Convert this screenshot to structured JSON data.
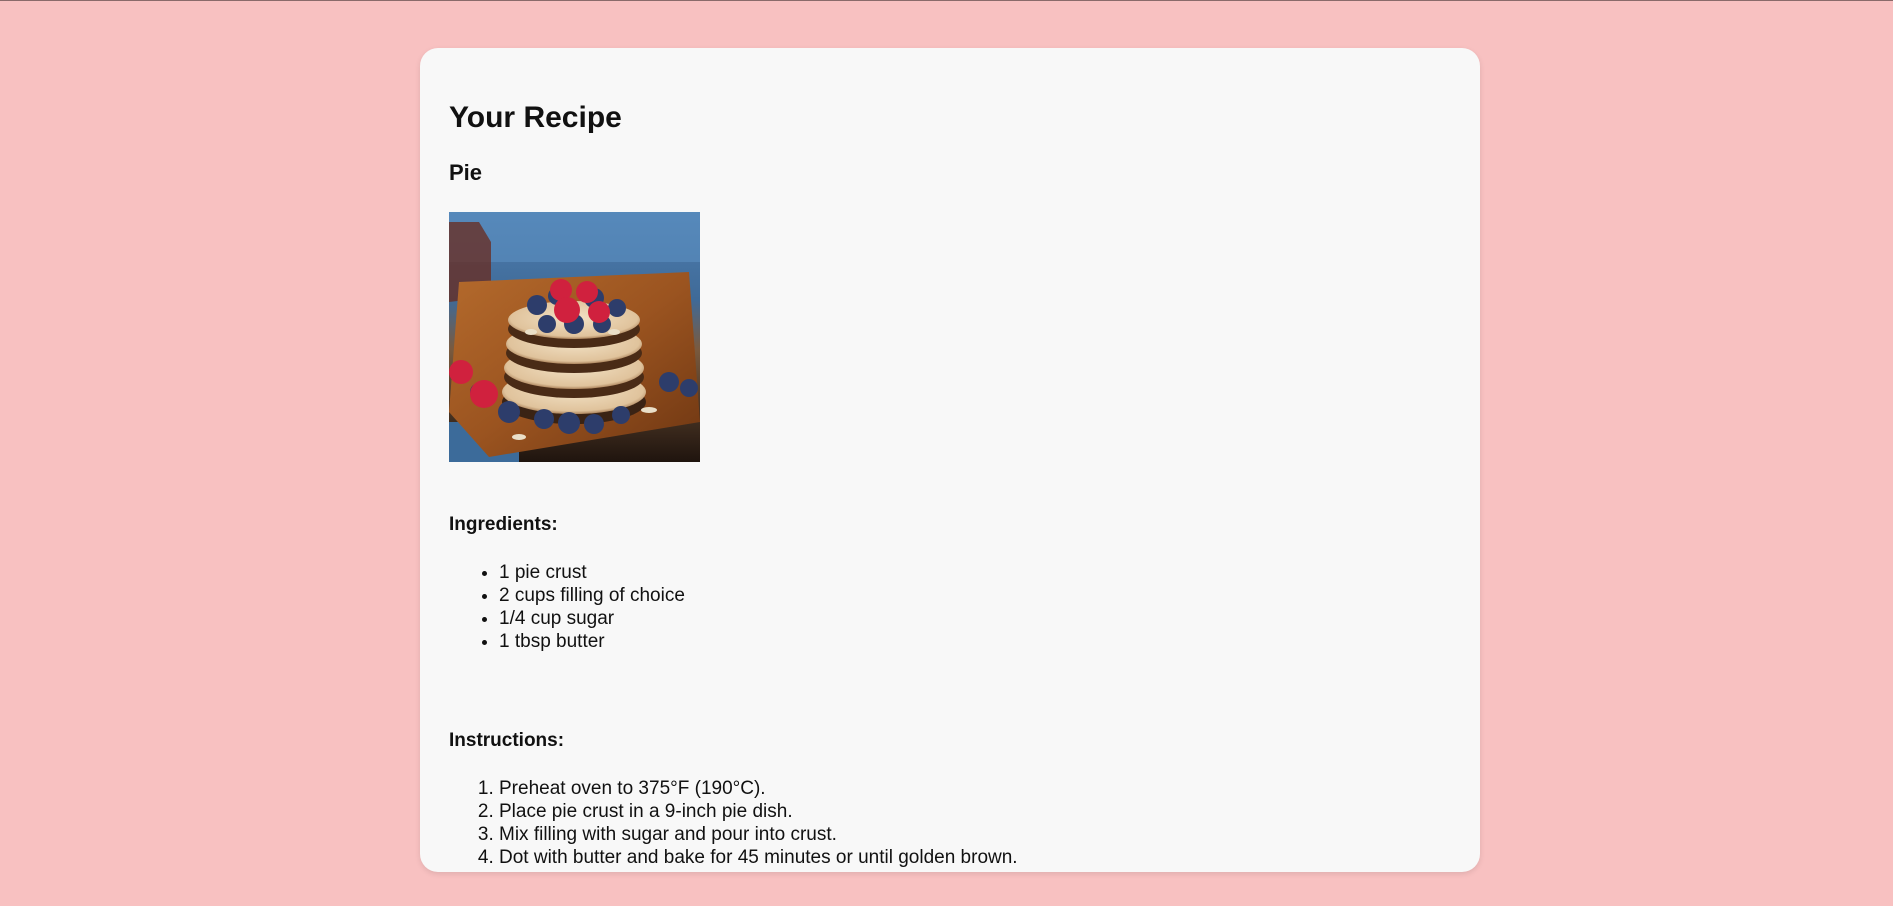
{
  "page": {
    "title": "Your Recipe",
    "recipe_name": "Pie"
  },
  "image": {
    "alt": "Stack of pancakes with raspberries and blueberries on a wooden plate"
  },
  "ingredients": {
    "heading": "Ingredients:",
    "items": [
      "1 pie crust",
      "2 cups filling of choice",
      "1/4 cup sugar",
      "1 tbsp butter"
    ]
  },
  "instructions": {
    "heading": "Instructions:",
    "steps": [
      "Preheat oven to 375°F (190°C).",
      "Place pie crust in a 9-inch pie dish.",
      "Mix filling with sugar and pour into crust.",
      "Dot with butter and bake for 45 minutes or until golden brown."
    ]
  },
  "colors": {
    "background": "#f8c1c1",
    "card": "#f8f8f8",
    "text": "#111111"
  }
}
